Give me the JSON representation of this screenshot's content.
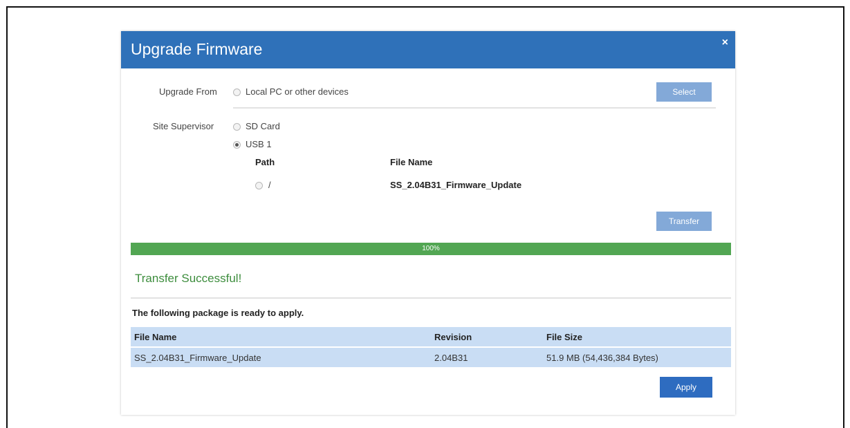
{
  "dialog": {
    "title": "Upgrade Firmware",
    "close_symbol": "×"
  },
  "upgrade_from": {
    "label": "Upgrade From",
    "option_local": "Local PC or other devices",
    "select_button": "Select"
  },
  "site_supervisor": {
    "label": "Site Supervisor",
    "option_sd": "SD Card",
    "option_usb": "USB 1",
    "selected": "USB 1",
    "files_header": {
      "path": "Path",
      "file_name": "File Name"
    },
    "files": [
      {
        "path": "/",
        "file_name": "SS_2.04B31_Firmware_Update"
      }
    ],
    "transfer_button": "Transfer"
  },
  "progress": {
    "value": 1.0,
    "label": "100%"
  },
  "status": {
    "message": "Transfer Successful!",
    "ready_text": "The following package is ready to apply."
  },
  "package_table": {
    "headers": [
      "File Name",
      "Revision",
      "File Size"
    ],
    "rows": [
      [
        "SS_2.04B31_Firmware_Update",
        "2.04B31",
        "51.9 MB (54,436,384 Bytes)"
      ]
    ]
  },
  "apply_button": "Apply",
  "colors": {
    "header_bg": "#2f71b9",
    "progress_fill": "#52a653",
    "success_text": "#3d8d3d",
    "table_row_bg": "#c9ddf4",
    "apply_button_bg": "#2e6cc0",
    "disabled_button_bg": "#83a9d8"
  }
}
